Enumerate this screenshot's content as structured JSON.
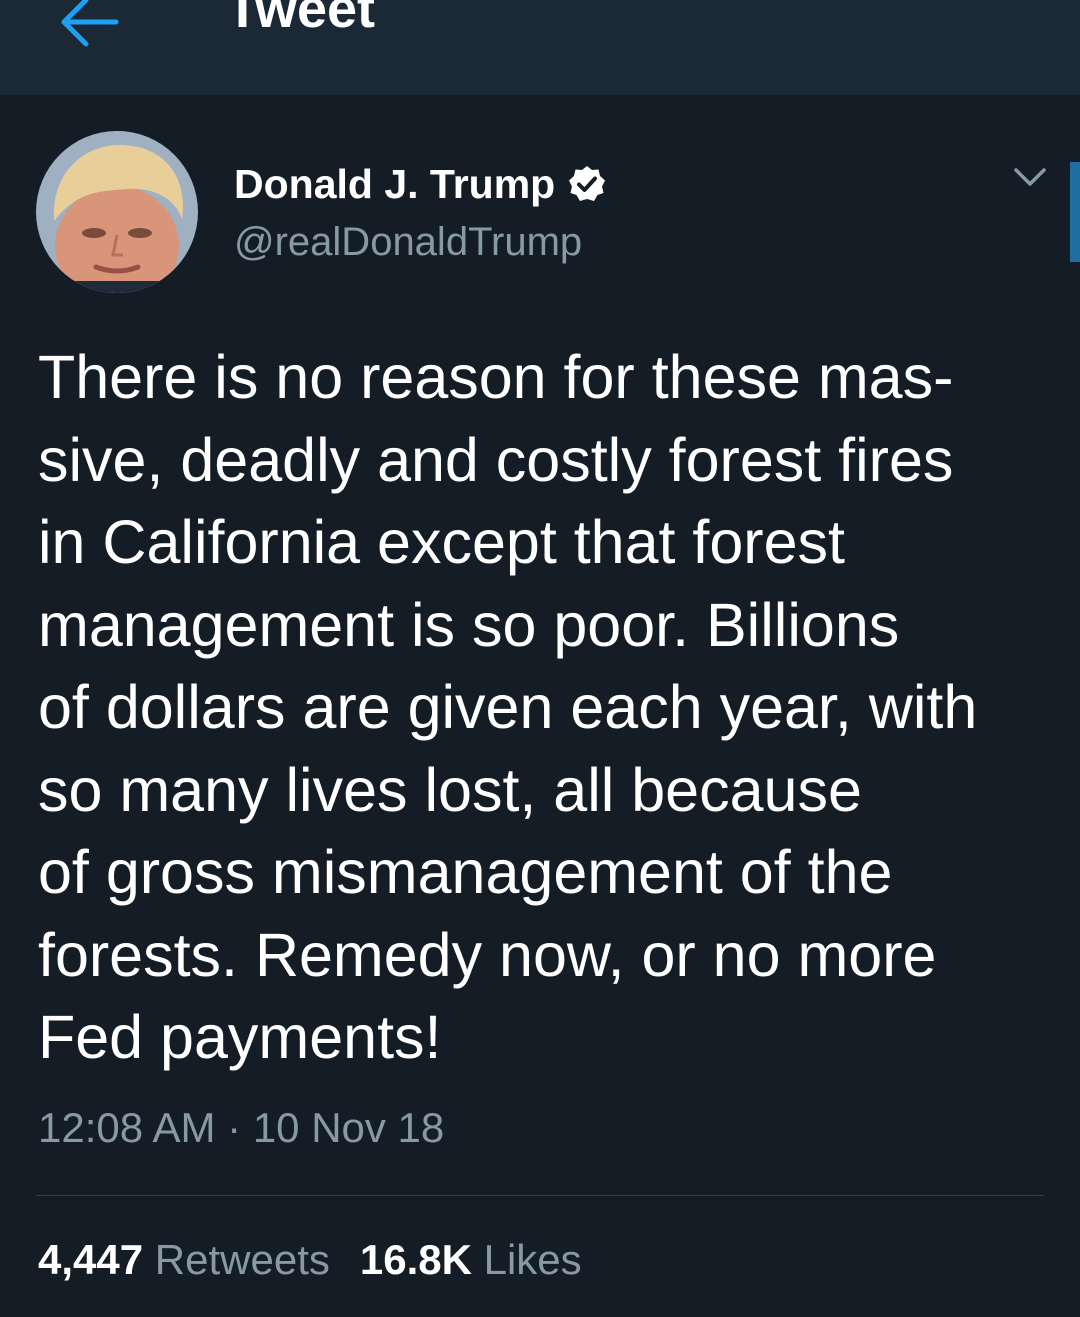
{
  "header": {
    "title": "Tweet",
    "back_icon": "arrow-left-icon",
    "accent_color": "#1da1f2"
  },
  "author": {
    "display_name": "Donald J. Trump",
    "handle": "@realDonaldTrump",
    "verified": true,
    "verified_icon": "verified-badge-icon"
  },
  "tweet": {
    "text_lines": [
      "There is no reason for these mas-",
      "sive, deadly and costly forest fires",
      "in California except that forest",
      "management is so poor. Billions",
      "of dollars are given each year, with",
      "so many lives lost, all because",
      "of gross mismanagement of the",
      "forests. Remedy now, or no more",
      "Fed payments!"
    ],
    "time": "12:08 AM",
    "separator": "·",
    "date": "10 Nov 18",
    "menu_icon": "chevron-down-icon"
  },
  "stats": {
    "retweets_count": "4,447",
    "retweets_label": "Retweets",
    "likes_count": "16.8K",
    "likes_label": "Likes"
  },
  "colors": {
    "background": "#141d26",
    "header_background": "#1b2836",
    "secondary_text": "#8899a6",
    "primary_text": "#ffffff"
  }
}
